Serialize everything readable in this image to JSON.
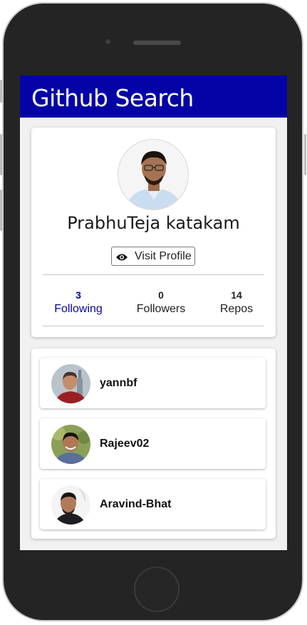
{
  "app": {
    "title": "Github Search",
    "brand_color": "#0404a6"
  },
  "profile": {
    "name": "PrabhuTeja katakam",
    "visit_label": "Visit Profile",
    "visit_icon": "eye-icon",
    "stats": [
      {
        "value": "3",
        "label": "Following",
        "active": true
      },
      {
        "value": "0",
        "label": "Followers",
        "active": false
      },
      {
        "value": "14",
        "label": "Repos",
        "active": false
      }
    ]
  },
  "following": [
    {
      "username": "yannbf"
    },
    {
      "username": "Rajeev02"
    },
    {
      "username": "Aravind-Bhat"
    }
  ]
}
